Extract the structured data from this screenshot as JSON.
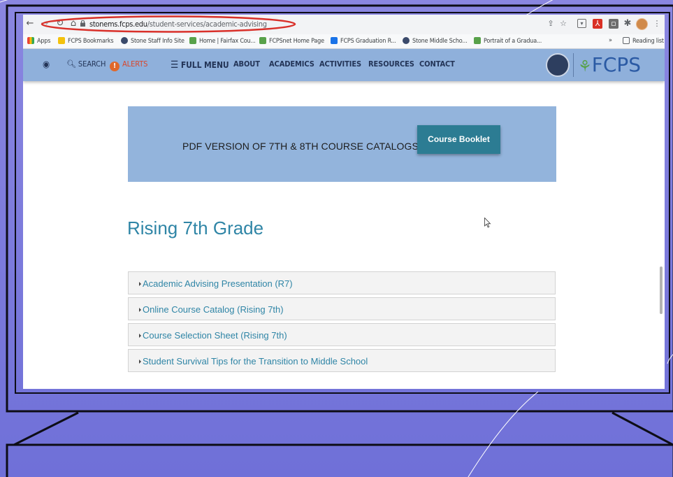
{
  "browser": {
    "url_host": "stonems.fcps.edu",
    "url_path": "/student-services/academic-advising",
    "bookmarks": [
      {
        "label": "Apps",
        "color": "#4285f4"
      },
      {
        "label": "FCPS Bookmarks",
        "color": "#f4c20d"
      },
      {
        "label": "Stone Staff Info Site",
        "color": "#3b4a6b"
      },
      {
        "label": "Home | Fairfax Cou...",
        "color": "#58a14a"
      },
      {
        "label": "FCPSnet Home Page",
        "color": "#58a14a"
      },
      {
        "label": "FCPS Graduation R...",
        "color": "#1a73e8"
      },
      {
        "label": "Stone Middle Scho...",
        "color": "#3b4a6b"
      },
      {
        "label": "Portrait of a Gradua...",
        "color": "#58a14a"
      }
    ],
    "overflow_label": "»",
    "reading_list_label": "Reading list"
  },
  "site_nav": {
    "search_label": "SEARCH",
    "alerts_label": "ALERTS",
    "full_menu_label": "FULL MENU",
    "items": [
      "ABOUT",
      "ACADEMICS",
      "ACTIVITIES",
      "RESOURCES",
      "CONTACT"
    ],
    "logo_text": "FCPS"
  },
  "promo": {
    "text": "PDF VERSION OF 7TH & 8TH COURSE CATALOGS.",
    "button_label": "Course Booklet"
  },
  "section": {
    "heading": "Rising 7th Grade",
    "items": [
      "Academic Advising Presentation (R7)",
      "Online Course Catalog (Rising 7th)",
      "Course Selection Sheet (Rising 7th)",
      "Student Survival Tips for the Transition to Middle School"
    ]
  },
  "colors": {
    "background": "#7f7fdc",
    "nav_bg": "#8fb0db",
    "accent_teal": "#2c7c93",
    "link_blue": "#2f85a6",
    "highlight_red": "#d9302a"
  }
}
